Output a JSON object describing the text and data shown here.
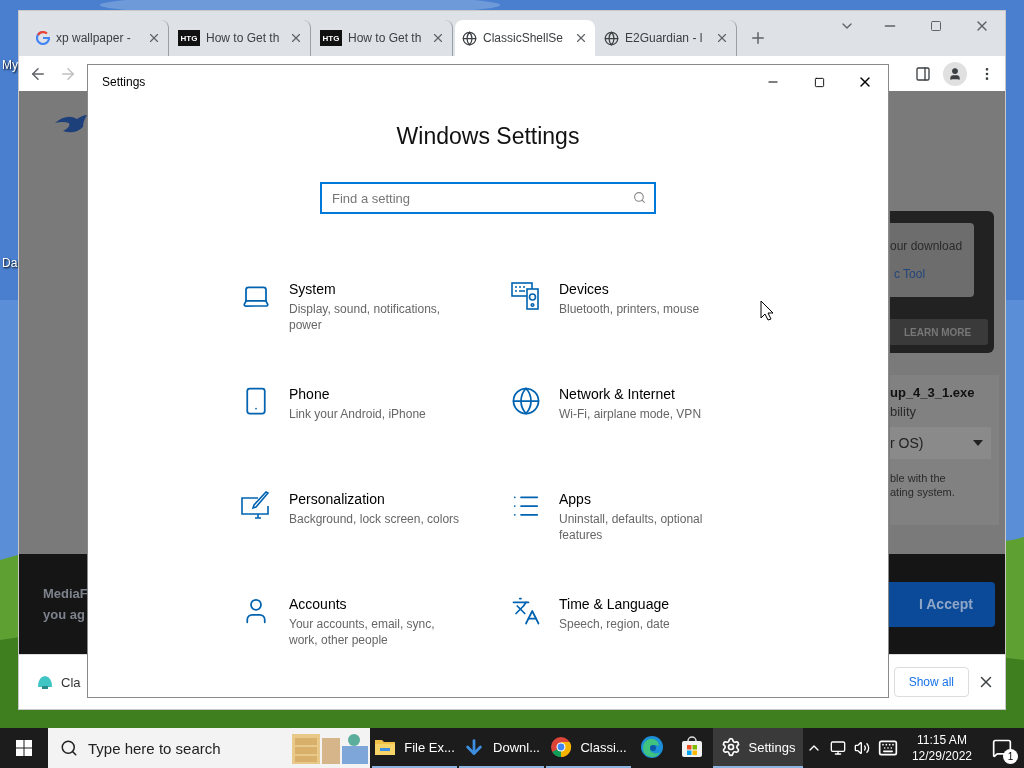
{
  "desktop": {
    "icons": [
      {
        "label": "My"
      },
      {
        "label": "Da"
      }
    ]
  },
  "browser": {
    "tabs": [
      {
        "kind": "google",
        "title": "xp wallpaper -",
        "selected": false
      },
      {
        "kind": "logo",
        "logo_text": "HTG",
        "title": "How to Get th",
        "selected": false
      },
      {
        "kind": "logo",
        "logo_text": "HTG",
        "title": "How to Get th",
        "selected": false
      },
      {
        "kind": "globe",
        "title": "ClassicShellSe",
        "selected": true
      },
      {
        "kind": "globe",
        "title": "E2Guardian - l",
        "selected": false
      }
    ],
    "nav": {
      "back_disabled": false,
      "forward_disabled": true
    },
    "page": {
      "promo": {
        "lines": [
          "our download",
          "c Tool"
        ],
        "button": "LEARN MORE"
      },
      "file": {
        "name": "up_4_3_1.exe",
        "subtitle": "bility",
        "select_value": "r OS)",
        "note_lines": [
          "ble with the",
          "ating system."
        ]
      },
      "banner": {
        "text_lines": [
          "MediaF",
          "you ag"
        ],
        "button": "I Accept"
      }
    },
    "downloads": {
      "items": [
        {
          "name": "Cla"
        }
      ],
      "show_all": "Show all"
    }
  },
  "settings": {
    "title": "Settings",
    "heading": "Windows Settings",
    "search": {
      "placeholder": "Find a setting"
    },
    "items": [
      {
        "kind": "laptop",
        "title": "System",
        "description_lines": [
          "Display, sound, notifications,",
          "power"
        ]
      },
      {
        "kind": "devices",
        "title": "Devices",
        "description_lines": [
          "Bluetooth, printers, mouse"
        ]
      },
      {
        "kind": "phone",
        "title": "Phone",
        "description_lines": [
          "Link your Android, iPhone"
        ]
      },
      {
        "kind": "globe",
        "title": "Network & Internet",
        "description_lines": [
          "Wi-Fi, airplane mode, VPN"
        ]
      },
      {
        "kind": "brush",
        "title": "Personalization",
        "description_lines": [
          "Background, lock screen, colors"
        ]
      },
      {
        "kind": "list",
        "title": "Apps",
        "description_lines": [
          "Uninstall, defaults, optional",
          "features"
        ]
      },
      {
        "kind": "user",
        "title": "Accounts",
        "description_lines": [
          "Your accounts, email, sync,",
          "work, other people"
        ]
      },
      {
        "kind": "language",
        "title": "Time & Language",
        "description_lines": [
          "Speech, region, date"
        ]
      }
    ]
  },
  "taskbar": {
    "search_placeholder": "Type here to search",
    "apps": [
      {
        "kind": "folder",
        "label": "File Ex...",
        "running": true,
        "selected": false
      },
      {
        "kind": "download",
        "label": "Downl...",
        "running": true,
        "selected": false
      },
      {
        "kind": "chrome",
        "label": "Classi...",
        "running": true,
        "selected": false
      },
      {
        "kind": "edge",
        "running": false,
        "selected": false
      },
      {
        "kind": "store",
        "running": false,
        "selected": false
      },
      {
        "kind": "gear",
        "label": "Settings",
        "running": true,
        "selected": true
      }
    ],
    "time": "11:15 AM",
    "date": "12/29/2022",
    "notifications": "1"
  }
}
